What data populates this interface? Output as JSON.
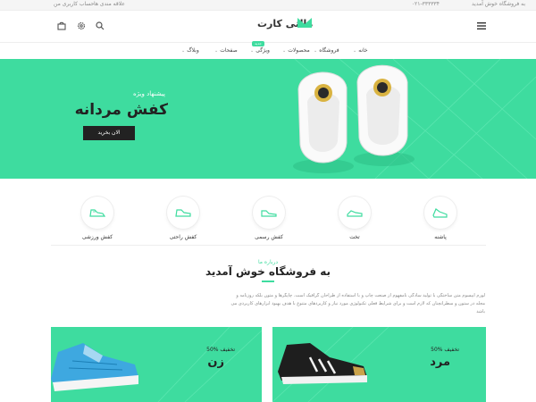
{
  "topbar": {
    "welcome": "به فروشگاه خوش آمدید",
    "phone": "۰۲۱-۳۳۳۳۳۴",
    "wishlist": "علاقه مندی ها",
    "account": "حساب کاربری من"
  },
  "header": {
    "logo_text": "مالتی کارت"
  },
  "menu": {
    "items": [
      {
        "label": "خانه"
      },
      {
        "label": "فروشگاه"
      },
      {
        "label": "محصولات"
      },
      {
        "label": "ویژگی"
      },
      {
        "label": "صفحات"
      },
      {
        "label": "وبلاگ"
      }
    ],
    "badge": "جدید"
  },
  "hero": {
    "subtitle": "پیشنهاد ویژه",
    "title": "کفش مردانه",
    "button": "الان بخرید"
  },
  "features": [
    {
      "label": "پاشنه"
    },
    {
      "label": "تخت"
    },
    {
      "label": "کفش رسمی"
    },
    {
      "label": "کفش راحتی"
    },
    {
      "label": "کفش ورزشی"
    }
  ],
  "about": {
    "small": "درباره ما",
    "title": "به فروشگاه خوش آمدید",
    "lines": [
      "لورم ایپسوم متن ساختگی با تولید سادگی نامفهوم از صنعت چاپ و با استفاده از طراحان گرافیک است. چاپگرها و متون بلکه روزنامه و",
      "مجله در ستون و سطرآنچنان که لازم است و برای شرایط فعلی تکنولوژی مورد نیاز و کاربردهای متنوع با هدف بهبود ابزارهای کاربردی می",
      "باشد"
    ]
  },
  "banners": [
    {
      "discount": "50% تخفیف",
      "title": "مرد"
    },
    {
      "discount": "50% تخفیف",
      "title": "زن"
    }
  ],
  "colors": {
    "accent": "#3edc9f",
    "dark": "#222222"
  }
}
